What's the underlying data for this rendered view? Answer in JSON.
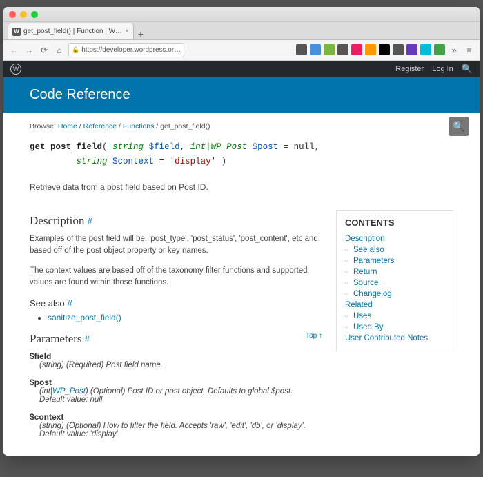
{
  "tab": {
    "title": "get_post_field() | Function | W…"
  },
  "url": "https://developer.wordpress.or…",
  "wpadmin": {
    "register": "Register",
    "login": "Log In"
  },
  "header": {
    "title": "Code Reference"
  },
  "breadcrumb": {
    "prefix": "Browse:",
    "home": "Home",
    "reference": "Reference",
    "functions": "Functions",
    "current": "get_post_field()"
  },
  "signature": {
    "fn": "get_post_field",
    "p1_type": "string",
    "p1_name": "$field",
    "p2_type": "int|WP_Post",
    "p2_name": "$post",
    "p2_def": "null",
    "p3_type": "string",
    "p3_name": "$context",
    "p3_def": "'display'"
  },
  "summary": "Retrieve data from a post field based on Post ID.",
  "sections": {
    "description": "Description",
    "desc_p1": "Examples of the post field will be, 'post_type', 'post_status', 'post_content', etc and based off of the post object property or key names.",
    "desc_p2": "The context values are based off of the taxonomy filter functions and supported values are found within those functions.",
    "seealso": "See also",
    "seealso_link": "sanitize_post_field()",
    "parameters": "Parameters",
    "top": "Top ↑"
  },
  "params": {
    "field": {
      "name": "$field",
      "desc": "(string) (Required) Post field name."
    },
    "post": {
      "name": "$post",
      "type_pre": "(int|",
      "type_link": "WP_Post",
      "desc_rest": ") (Optional) Post ID or post object. Defaults to global $post.",
      "default": "Default value: null"
    },
    "context": {
      "name": "$context",
      "desc": "(string) (Optional) How to filter the field. Accepts 'raw', 'edit', 'db', or 'display'.",
      "default": "Default value: 'display'"
    }
  },
  "toc": {
    "title": "CONTENTS",
    "description": "Description",
    "seealso": "See also",
    "parameters": "Parameters",
    "return": "Return",
    "source": "Source",
    "changelog": "Changelog",
    "related": "Related",
    "uses": "Uses",
    "usedby": "Used By",
    "notes": "User Contributed Notes"
  }
}
